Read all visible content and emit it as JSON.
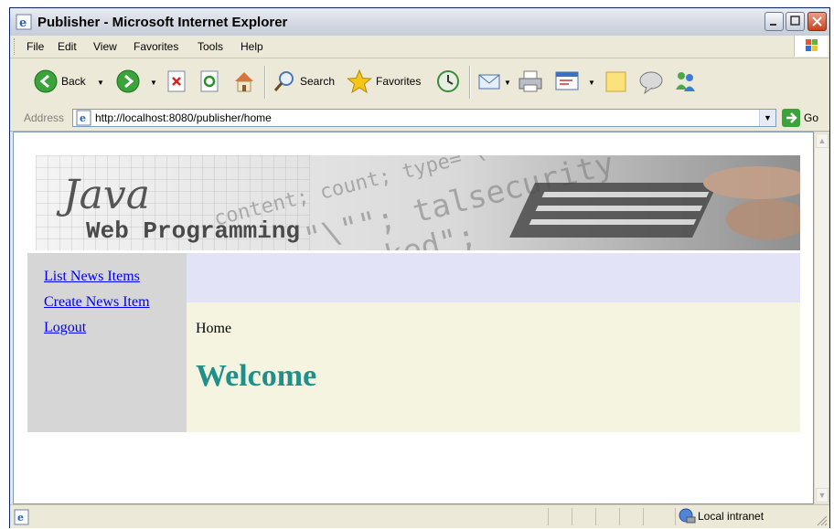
{
  "window": {
    "title": "Publisher - Microsoft Internet Explorer"
  },
  "menu": [
    "File",
    "Edit",
    "View",
    "Favorites",
    "Tools",
    "Help"
  ],
  "toolbar": {
    "back": "Back",
    "search": "Search",
    "favorites": "Favorites"
  },
  "address": {
    "label": "Address",
    "url": "http://localhost:8080/publisher/home",
    "go": "Go"
  },
  "page": {
    "banner": {
      "title": "Java",
      "subtitle": "Web Programming"
    },
    "nav": [
      "List News Items",
      "Create News Item",
      "Logout"
    ],
    "breadcrumb": "Home",
    "heading": "Welcome"
  },
  "status": {
    "zone": "Local intranet"
  },
  "colors": {
    "welcome": "#1f8f8a",
    "nav_bg": "#d6d6d6",
    "content_bg": "#f4f4e0",
    "header_bg": "#e3e3f8"
  }
}
